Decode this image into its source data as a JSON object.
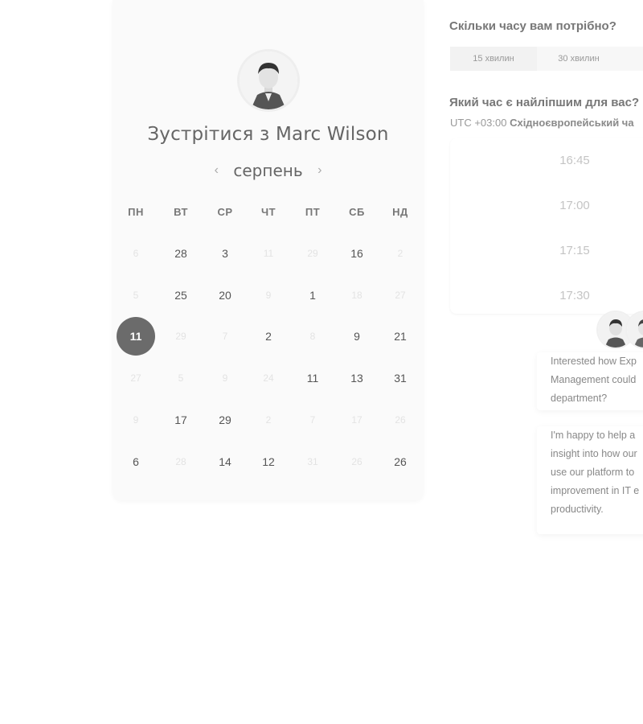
{
  "host": {
    "title": "Зустрітися з Marc Wilson"
  },
  "calendar": {
    "month": "серпень",
    "prev_icon": "chevron-left-icon",
    "next_icon": "chevron-right-icon",
    "weekdays": [
      "ПН",
      "ВТ",
      "СР",
      "ЧТ",
      "ПТ",
      "СБ",
      "НД"
    ],
    "weeks": [
      [
        {
          "d": "6",
          "s": "muted"
        },
        {
          "d": "28",
          "s": "active"
        },
        {
          "d": "3",
          "s": "active"
        },
        {
          "d": "11",
          "s": "muted"
        },
        {
          "d": "29",
          "s": "muted"
        },
        {
          "d": "16",
          "s": "active"
        },
        {
          "d": "2",
          "s": "muted"
        }
      ],
      [
        {
          "d": "5",
          "s": "muted"
        },
        {
          "d": "25",
          "s": "active"
        },
        {
          "d": "20",
          "s": "active"
        },
        {
          "d": "9",
          "s": "muted"
        },
        {
          "d": "1",
          "s": "active"
        },
        {
          "d": "18",
          "s": "muted"
        },
        {
          "d": "27",
          "s": "muted"
        }
      ],
      [
        {
          "d": "11",
          "s": "selected"
        },
        {
          "d": "29",
          "s": "muted"
        },
        {
          "d": "7",
          "s": "muted"
        },
        {
          "d": "2",
          "s": "active"
        },
        {
          "d": "8",
          "s": "muted"
        },
        {
          "d": "9",
          "s": "active"
        },
        {
          "d": "21",
          "s": "active"
        }
      ],
      [
        {
          "d": "27",
          "s": "muted"
        },
        {
          "d": "5",
          "s": "muted"
        },
        {
          "d": "9",
          "s": "muted"
        },
        {
          "d": "24",
          "s": "muted"
        },
        {
          "d": "11",
          "s": "active"
        },
        {
          "d": "13",
          "s": "active"
        },
        {
          "d": "31",
          "s": "active"
        }
      ],
      [
        {
          "d": "9",
          "s": "muted"
        },
        {
          "d": "17",
          "s": "active"
        },
        {
          "d": "29",
          "s": "active"
        },
        {
          "d": "2",
          "s": "muted"
        },
        {
          "d": "7",
          "s": "muted"
        },
        {
          "d": "17",
          "s": "muted"
        },
        {
          "d": "26",
          "s": "muted"
        }
      ],
      [
        {
          "d": "6",
          "s": "active"
        },
        {
          "d": "28",
          "s": "muted"
        },
        {
          "d": "14",
          "s": "active"
        },
        {
          "d": "12",
          "s": "active"
        },
        {
          "d": "31",
          "s": "muted"
        },
        {
          "d": "26",
          "s": "muted"
        },
        {
          "d": "26",
          "s": "active"
        }
      ]
    ]
  },
  "duration": {
    "question": "Скільки часу вам потрібно?",
    "options": [
      "15 хвилин",
      "30 хвилин"
    ]
  },
  "time": {
    "question": "Який час є найліпшим для вас?",
    "tz_prefix": "UTC +03:00",
    "tz_name": "Східноєвропейський ча",
    "slots": [
      "16:45",
      "17:00",
      "17:15",
      "17:30"
    ]
  },
  "chat": {
    "bubble1": [
      "Interested how Exp",
      "Management could",
      "department?"
    ],
    "bubble2": [
      "I'm happy to help a",
      "insight into how our",
      "use our platform to",
      "improvement in IT e",
      "productivity."
    ]
  },
  "colors": {
    "selected_day": "#6b6b6b",
    "card_bg": "#fafafa"
  }
}
